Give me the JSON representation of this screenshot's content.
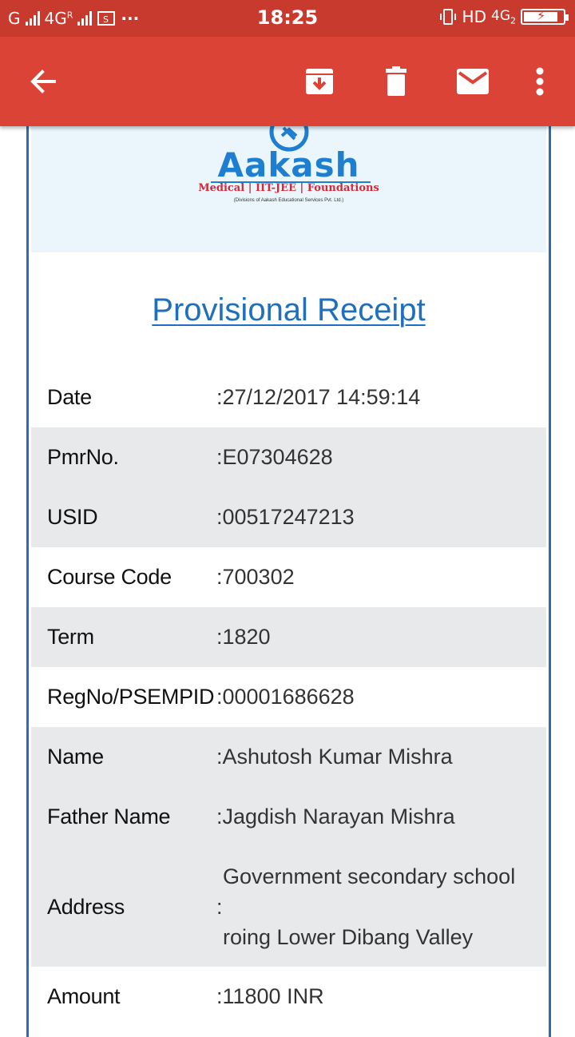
{
  "status_bar": {
    "carrier_left": "G",
    "network_left": "4G",
    "network_left_sup": "R",
    "more_dots": "···",
    "time": "18:25",
    "hd": "HD",
    "network_right": "4G",
    "network_right_sub": "2",
    "icons": [
      "signal-icon",
      "screenshot-icon",
      "vibrate-icon",
      "battery-charging-icon"
    ]
  },
  "app_bar": {
    "icons": [
      "back-arrow-icon",
      "archive-icon",
      "delete-icon",
      "mail-icon",
      "more-vert-icon"
    ],
    "colors": {
      "status": "#c73a2d",
      "toolbar": "#dc4337"
    }
  },
  "logo": {
    "name": "Aakash",
    "tagline": "Medical | IIT-JEE | Foundations",
    "sub": "(Divisions of Aakash Educational Services Pvt. Ltd.)"
  },
  "receipt": {
    "title": "Provisional Receipt",
    "rows": [
      {
        "label": "Date",
        "value": ":27/12/2017 14:59:14"
      },
      {
        "label": "PmrNo.",
        "value": ":E07304628"
      },
      {
        "label": "USID",
        "value": ":00517247213"
      },
      {
        "label": "Course Code",
        "value": ":700302"
      },
      {
        "label": "Term",
        "value": ":1820"
      },
      {
        "label": "RegNo/PSEMPID",
        "value": ":00001686628"
      },
      {
        "label": "Name",
        "value": ":Ashutosh Kumar Mishra"
      },
      {
        "label": "Father Name",
        "value": ":Jagdish Narayan Mishra"
      },
      {
        "label": "Address",
        "value_line1": "Government secondary school",
        "value_colon": ":",
        "value_line2": "roing Lower Dibang Valley"
      },
      {
        "label": "Amount",
        "value": ":11800 INR"
      }
    ]
  }
}
